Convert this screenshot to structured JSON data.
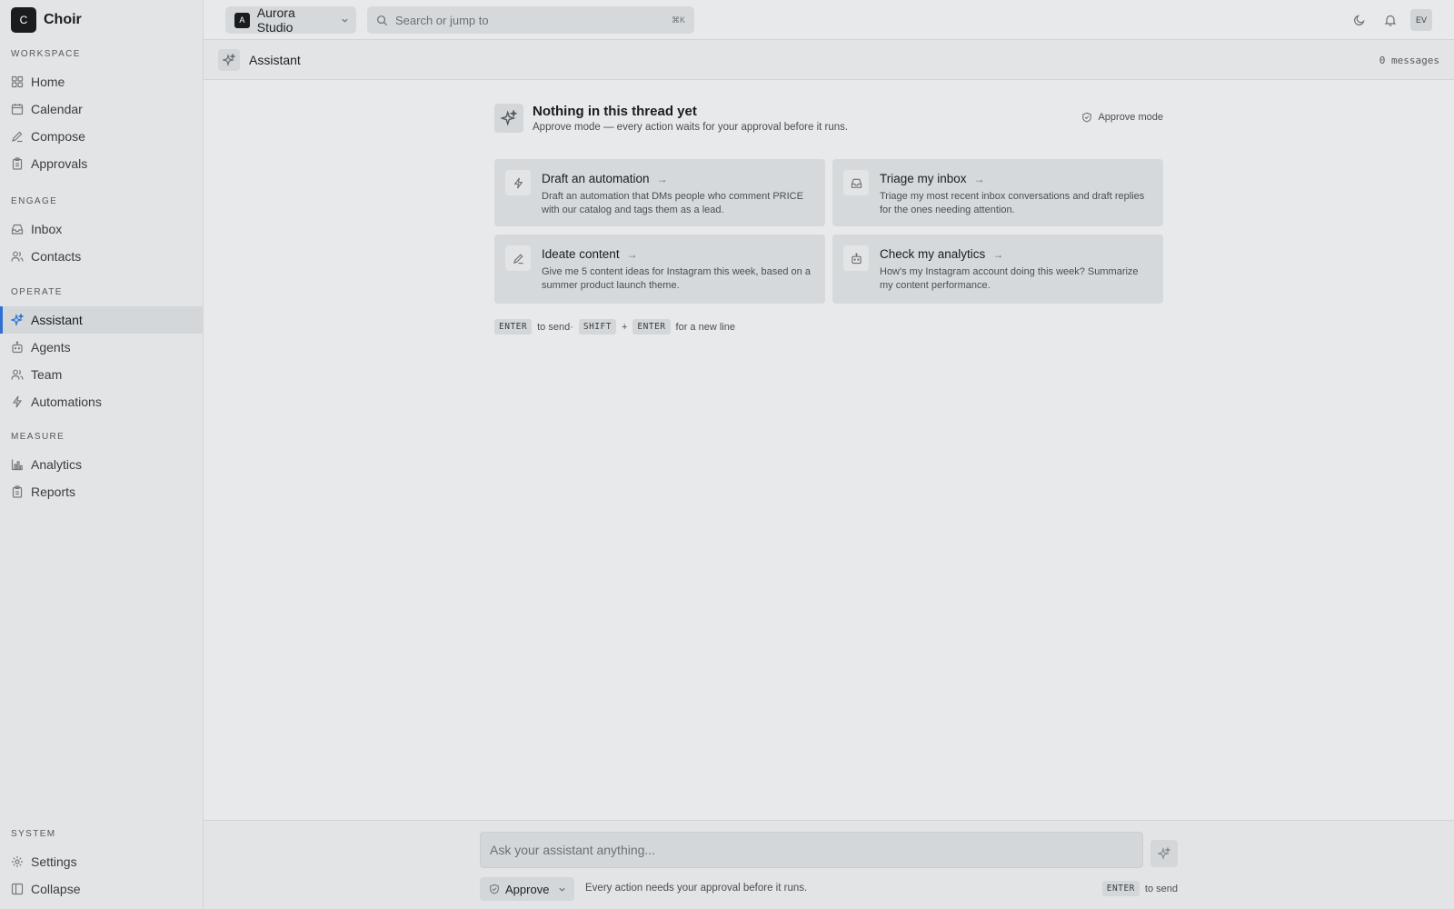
{
  "brand": {
    "logo_letter": "C",
    "name": "Choir"
  },
  "sidebar": {
    "sections": [
      {
        "heading": "WORKSPACE",
        "items": [
          {
            "label": "Home",
            "icon": "grid-icon"
          },
          {
            "label": "Calendar",
            "icon": "calendar-icon"
          },
          {
            "label": "Compose",
            "icon": "pencil-icon"
          },
          {
            "label": "Approvals",
            "icon": "clipboard-icon"
          }
        ]
      },
      {
        "heading": "ENGAGE",
        "items": [
          {
            "label": "Inbox",
            "icon": "inbox-icon"
          },
          {
            "label": "Contacts",
            "icon": "users-icon"
          }
        ]
      },
      {
        "heading": "OPERATE",
        "items": [
          {
            "label": "Assistant",
            "icon": "sparkle-icon",
            "active": true
          },
          {
            "label": "Agents",
            "icon": "bot-icon"
          },
          {
            "label": "Team",
            "icon": "users-icon"
          },
          {
            "label": "Automations",
            "icon": "bolt-icon"
          }
        ]
      },
      {
        "heading": "MEASURE",
        "items": [
          {
            "label": "Analytics",
            "icon": "bar-chart-icon"
          },
          {
            "label": "Reports",
            "icon": "clipboard-icon"
          }
        ]
      },
      {
        "heading": "SYSTEM",
        "items": [
          {
            "label": "Settings",
            "icon": "gear-icon"
          },
          {
            "label": "Collapse",
            "icon": "sidebar-collapse-icon"
          }
        ]
      }
    ]
  },
  "topbar": {
    "workspace": {
      "logo_letter": "A",
      "name": "Aurora Studio"
    },
    "search": {
      "placeholder": "Search or jump to",
      "shortcut": "⌘K"
    },
    "avatar_initials": "EV"
  },
  "page": {
    "title": "Assistant",
    "message_count": "0 messages"
  },
  "thread": {
    "title": "Nothing in this thread yet",
    "subtitle": "Approve mode — every action waits for your approval before it runs.",
    "mode_label": "Approve mode"
  },
  "suggestions": [
    {
      "title": "Draft an automation",
      "icon": "bolt-icon",
      "description": "Draft an automation that DMs people who comment PRICE with our catalog and tags them as a lead."
    },
    {
      "title": "Triage my inbox",
      "icon": "inbox-icon",
      "description": "Triage my most recent inbox conversations and draft replies for the ones needing attention."
    },
    {
      "title": "Ideate content",
      "icon": "pencil-icon",
      "description": "Give me 5 content ideas for Instagram this week, based on a summer product launch theme."
    },
    {
      "title": "Check my analytics",
      "icon": "bot-icon",
      "description": "How's my Instagram account doing this week? Summarize my content performance."
    }
  ],
  "hint": {
    "key_enter": "ENTER",
    "to_send": "to send·",
    "key_shift": "SHIFT",
    "plus": "+",
    "key_enter2": "ENTER",
    "new_line": "for a new line"
  },
  "composer": {
    "placeholder": "Ask your assistant anything...",
    "approve_label": "Approve",
    "approve_note": "Every action needs your approval before it runs.",
    "send_key": "ENTER",
    "send_label": "to send"
  },
  "colors": {
    "accent": "#2f6fd4"
  }
}
